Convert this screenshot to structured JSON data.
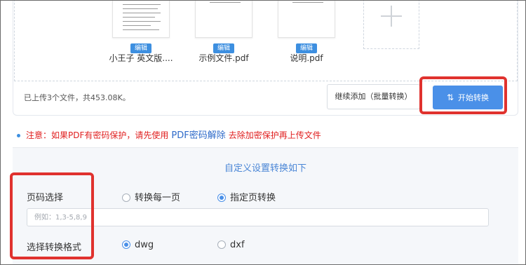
{
  "files": [
    {
      "name": "小王子 英文版....",
      "edit_label": "编辑"
    },
    {
      "name": "示例文件.pdf",
      "edit_label": "编辑"
    },
    {
      "name": "说明.pdf",
      "edit_label": "编辑"
    }
  ],
  "add_tile": {
    "icon": "plus-icon"
  },
  "upload_status": "已上传3个文件，共453.08K。",
  "continue_button": "继续添加（批量转换）",
  "start_button": {
    "label": "开始转换",
    "icon": "convert-arrows-icon"
  },
  "notice": {
    "prefix": "注意：如果PDF有密码保护，请先使用",
    "link": "PDF密码解除",
    "suffix": "去除加密保护再上传文件"
  },
  "settings": {
    "title": "自定义设置转换如下",
    "page_label": "页码选择",
    "page_options": [
      "转换每一页",
      "指定页转换"
    ],
    "page_selected": "指定页转换",
    "page_input_placeholder": "例如：1,3-5,8,9",
    "format_label": "选择转换格式",
    "format_options": [
      "dwg",
      "dxf"
    ],
    "format_selected": "dwg"
  },
  "colors": {
    "accent": "#4a90e8",
    "highlight": "#e0322e",
    "warning": "#e02020"
  }
}
